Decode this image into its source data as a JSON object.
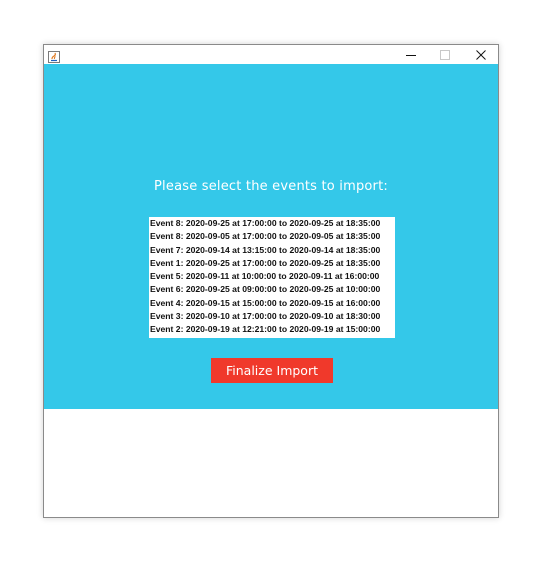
{
  "window": {
    "controls": {
      "minimize": "–",
      "maximize": "□",
      "close": "✕"
    },
    "app_icon": "java-icon"
  },
  "colors": {
    "panel_background": "#34c8e9",
    "button_background": "#f0392b",
    "text_on_panel": "#ffffff"
  },
  "main": {
    "prompt": "Please select the events to import:",
    "events": [
      "Event 8: 2020-09-25 at 17:00:00 to 2020-09-25 at 18:35:00",
      "Event 8: 2020-09-05 at 17:00:00 to 2020-09-05 at 18:35:00",
      "Event 7: 2020-09-14 at 13:15:00 to 2020-09-14 at 18:35:00",
      "Event 1: 2020-09-25 at 17:00:00 to 2020-09-25 at 18:35:00",
      "Event 5: 2020-09-11 at 10:00:00 to 2020-09-11 at 16:00:00",
      "Event 6: 2020-09-25 at 09:00:00 to 2020-09-25 at 10:00:00",
      "Event 4: 2020-09-15 at 15:00:00 to 2020-09-15 at 16:00:00",
      "Event 3: 2020-09-10 at 17:00:00 to 2020-09-10 at 18:30:00",
      "Event 2: 2020-09-19 at 12:21:00 to 2020-09-19 at 15:00:00"
    ],
    "finalize_label": "Finalize Import"
  }
}
